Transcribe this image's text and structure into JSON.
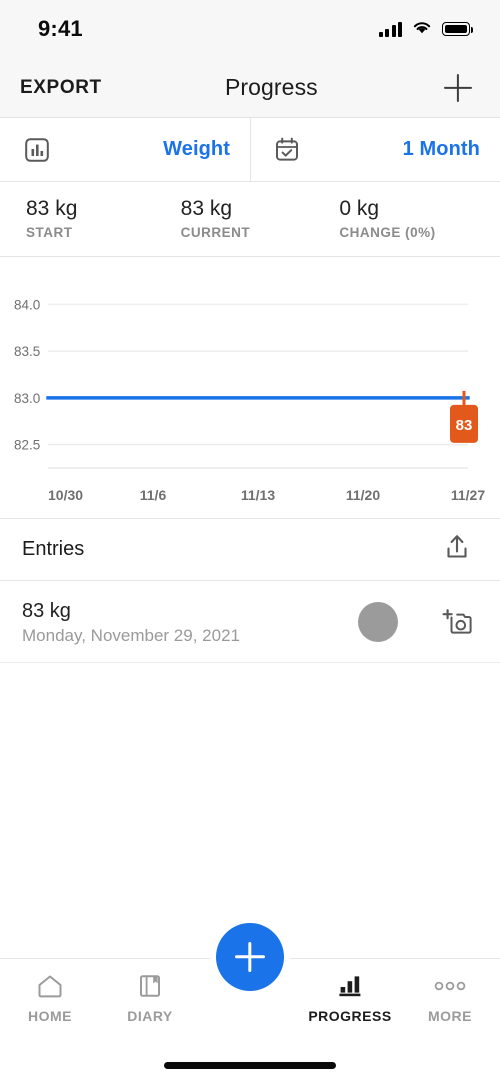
{
  "status_bar": {
    "time": "9:41",
    "signal_icon": "cellular-signal-icon",
    "wifi_icon": "wifi-icon",
    "battery_icon": "battery-full-icon"
  },
  "nav_bar": {
    "left_action": "EXPORT",
    "title": "Progress",
    "right_action_icon": "plus-icon"
  },
  "filters": {
    "metric": {
      "icon": "bar-chart-icon",
      "label": "Weight"
    },
    "range": {
      "icon": "calendar-check-icon",
      "label": "1 Month"
    },
    "accent_color": "#1a73e8"
  },
  "stats": [
    {
      "value": "83 kg",
      "caption": "START"
    },
    {
      "value": "83 kg",
      "caption": "CURRENT"
    },
    {
      "value": "0 kg",
      "caption": "CHANGE (0%)"
    }
  ],
  "chart_data": {
    "type": "line",
    "title": "",
    "xlabel": "",
    "ylabel": "",
    "x": [
      "10/30",
      "11/6",
      "11/13",
      "11/20",
      "11/27"
    ],
    "y_ticks": [
      "84.0",
      "83.5",
      "83.0",
      "82.5"
    ],
    "ylim": [
      82.25,
      84.25
    ],
    "grid": true,
    "legend": "none",
    "series": [
      {
        "name": "Weight",
        "color": "#1a73e8",
        "values": [
          83.0,
          83.0,
          83.0,
          83.0,
          83.0
        ]
      }
    ],
    "annotations": [
      {
        "name": "current-weight-badge",
        "label": "83",
        "value": 83.0,
        "color": "#e2591b",
        "text_color": "#ffffff"
      }
    ]
  },
  "entries_section": {
    "title": "Entries",
    "share_icon": "share-upload-icon",
    "rows": [
      {
        "value": "83 kg",
        "date": "Monday, November 29, 2021",
        "avatar": "photo-placeholder-circle",
        "camera_icon": "add-photo-icon"
      }
    ]
  },
  "tab_bar": {
    "fab_icon": "plus-icon",
    "fab_color": "#1a73e8",
    "tabs": [
      {
        "label": "HOME",
        "icon": "home-icon",
        "active": false
      },
      {
        "label": "DIARY",
        "icon": "book-icon",
        "active": false
      },
      {
        "label": "PROGRESS",
        "icon": "bar-chart-icon",
        "active": true
      },
      {
        "label": "MORE",
        "icon": "ellipsis-icon",
        "active": false
      }
    ]
  }
}
